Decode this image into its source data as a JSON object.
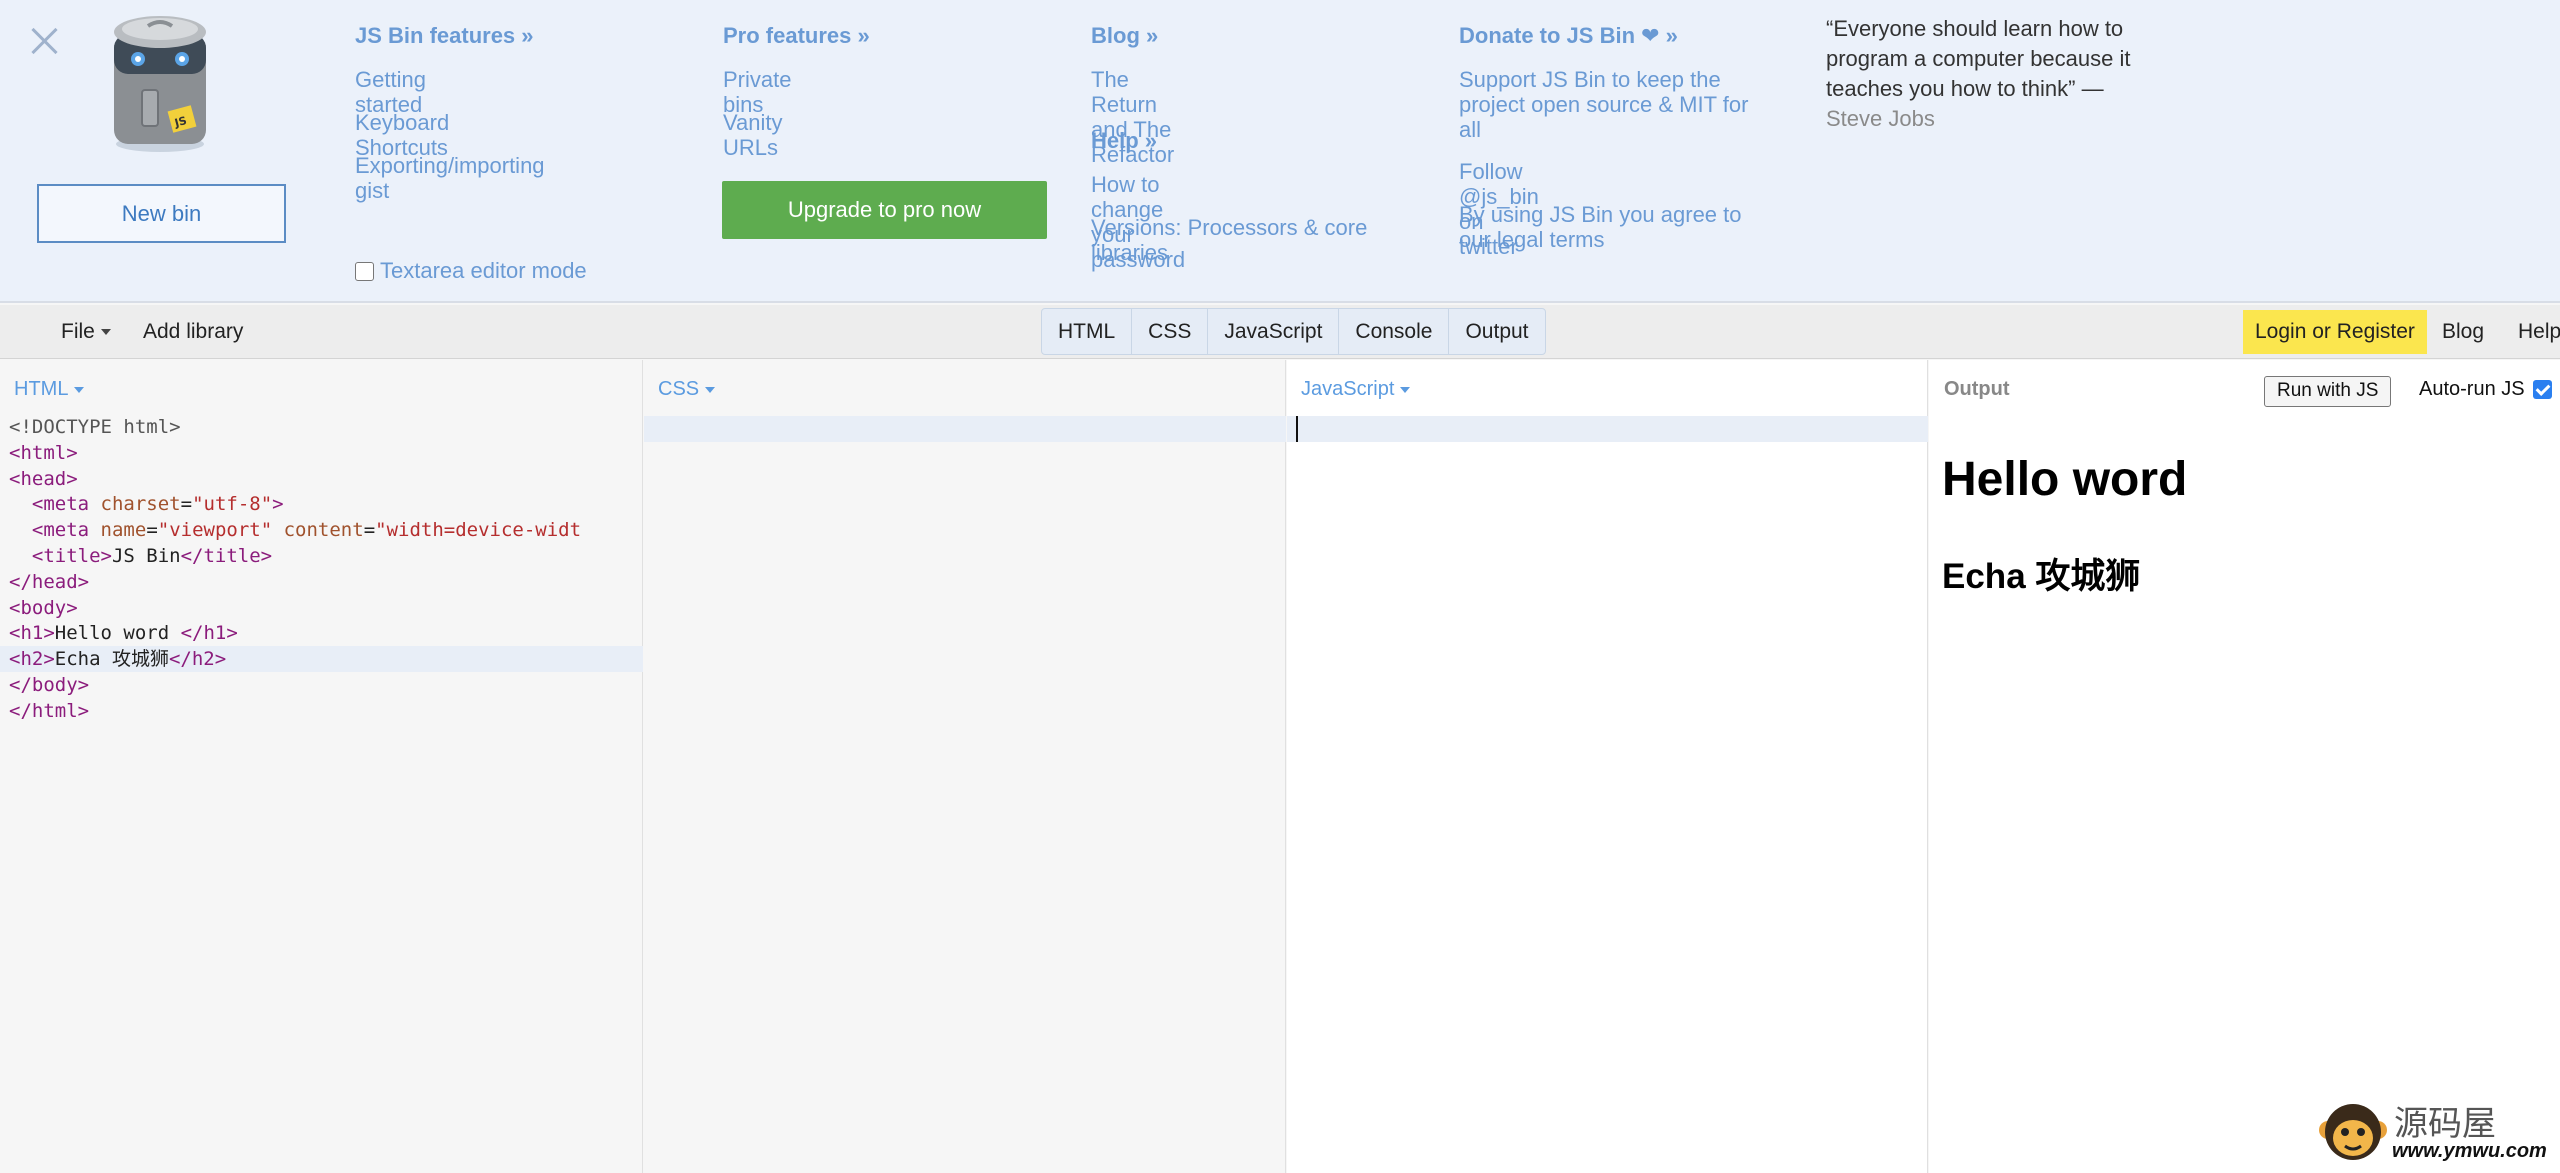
{
  "infocard": {
    "new_bin": "New bin",
    "columns": [
      {
        "heading": "JS Bin features »",
        "links": [
          "Getting started",
          "Keyboard Shortcuts",
          "Exporting/importing gist"
        ]
      },
      {
        "heading": "Pro features »",
        "links": [
          "Private bins",
          "Vanity URLs"
        ]
      },
      {
        "heading": "Blog »",
        "links": [
          "The Return and The Refactor"
        ]
      },
      {
        "heading": "Help »",
        "links": [
          "How to change your password",
          "Versions: Processors & core libraries"
        ]
      },
      {
        "heading": "Donate to JS Bin ❤ »",
        "links": [
          "Support JS Bin to keep the project open source & MIT for all",
          "Follow @js_bin on twitter",
          "By using JS Bin you agree to our legal terms"
        ]
      }
    ],
    "upgrade": "Upgrade to pro now",
    "textarea_mode": "Textarea editor mode",
    "quote": "“Everyone should learn how to program a computer because it teaches you how to think” —",
    "quote_author": "Steve Jobs"
  },
  "toolbar": {
    "file": "File",
    "add_library": "Add library",
    "tabs": [
      "HTML",
      "CSS",
      "JavaScript",
      "Console",
      "Output"
    ],
    "login": "Login or Register",
    "blog": "Blog",
    "help": "Help"
  },
  "panels": {
    "html_label": "HTML",
    "css_label": "CSS",
    "js_label": "JavaScript",
    "output_label": "Output",
    "run_button": "Run with JS",
    "autorun": "Auto-run JS"
  },
  "html_code": {
    "doctype": "<!DOCTYPE html>",
    "meta_viewport_content": "\"width=device-widt",
    "h1_text": "Hello word ",
    "h2_text": "Echa 攻城狮",
    "title_text": "JS Bin"
  },
  "output": {
    "h1": "Hello word",
    "h2": "Echa 攻城狮"
  },
  "watermark": {
    "name": "源码屋",
    "url": "www.ymwu.com"
  },
  "colors": {
    "link": "#6a9ad4",
    "upgrade": "#5eac4f",
    "login": "#fbe64e",
    "panel_label": "#5b9be0"
  }
}
